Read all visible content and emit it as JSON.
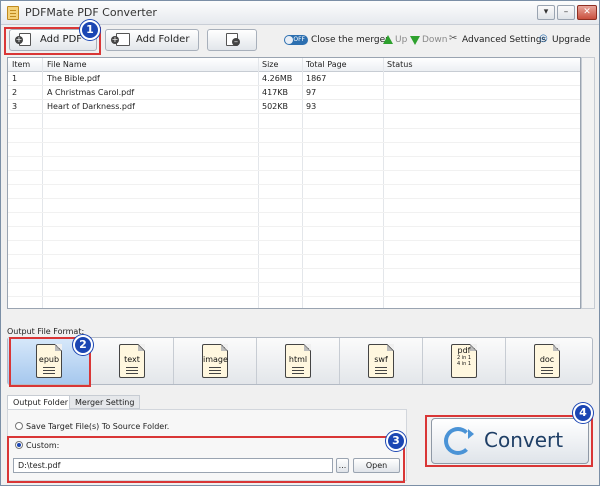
{
  "window": {
    "title": "PDFMate PDF Converter"
  },
  "toolbar": {
    "add_pdf": "Add PDF",
    "add_folder": "Add Folder",
    "merger_toggle": "OFF",
    "close_merger": "Close the merger",
    "up": "Up",
    "down": "Down",
    "advanced_settings": "Advanced Settings",
    "upgrade": "Upgrade"
  },
  "table": {
    "columns": [
      "Item",
      "File Name",
      "Size",
      "Total Page",
      "Status"
    ],
    "rows": [
      {
        "item": "1",
        "file_name": "The Bible.pdf",
        "size": "4.26MB",
        "total_page": "1867",
        "status": ""
      },
      {
        "item": "2",
        "file_name": "A Christmas Carol.pdf",
        "size": "417KB",
        "total_page": "97",
        "status": ""
      },
      {
        "item": "3",
        "file_name": "Heart of Darkness.pdf",
        "size": "502KB",
        "total_page": "93",
        "status": ""
      }
    ]
  },
  "output_format": {
    "label": "Output File Format:",
    "selected": "epub",
    "formats": [
      {
        "name": "epub",
        "extra": ""
      },
      {
        "name": "text",
        "extra": ""
      },
      {
        "name": "image",
        "extra": ""
      },
      {
        "name": "html",
        "extra": ""
      },
      {
        "name": "swf",
        "extra": ""
      },
      {
        "name": "pdf",
        "extra": "2 in 1 4 in 1"
      },
      {
        "name": "doc",
        "extra": ""
      }
    ]
  },
  "tabs": {
    "output_folder": "Output Folder",
    "merger_setting": "Merger Setting"
  },
  "output": {
    "save_to_source": "Save Target File(s) To Source Folder.",
    "custom": "Custom:",
    "path": "D:\\test.pdf",
    "browse": "...",
    "open": "Open"
  },
  "convert": {
    "label": "Convert"
  },
  "badges": [
    "1",
    "2",
    "3",
    "4"
  ],
  "colors": {
    "highlight": "#d93636",
    "badge": "#1b46b3",
    "selected_format": "#a6c8ee"
  }
}
